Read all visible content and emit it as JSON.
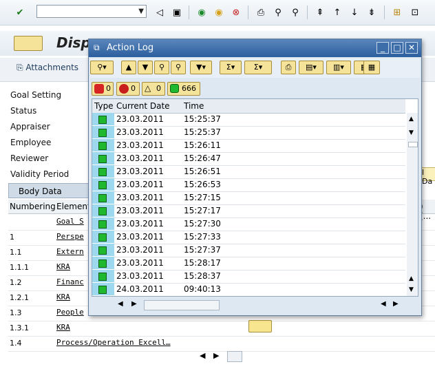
{
  "main": {
    "page_title": "Disp",
    "attachments_label": "Attachments",
    "fields": [
      "Goal Setting",
      "Status",
      "Appraiser",
      "Employee",
      "Reviewer",
      "Validity Period"
    ],
    "right_cell_text": "l Da",
    "body_tab": "Body Data",
    "grid_headers": {
      "numbering": "Numbering",
      "element": "Element",
      "right": ") (..."
    },
    "rows": [
      {
        "num": "",
        "elem": "Goal S"
      },
      {
        "num": "1",
        "elem": "Perspe"
      },
      {
        "num": "1.1",
        "elem": "Extern"
      },
      {
        "num": "1.1.1",
        "elem": "KRA"
      },
      {
        "num": "1.2",
        "elem": "Financ"
      },
      {
        "num": "1.2.1",
        "elem": "KRA"
      },
      {
        "num": "1.3",
        "elem": "People"
      },
      {
        "num": "1.3.1",
        "elem": "KRA"
      },
      {
        "num": "1.4",
        "elem": "Process/Operation Excell…"
      }
    ]
  },
  "dialog": {
    "title": "Action Log",
    "status": {
      "stop": "0",
      "error": "0",
      "warning": "0",
      "success": "666"
    },
    "columns": {
      "type": "Type",
      "date": "Current Date",
      "time": "Time"
    },
    "rows": [
      {
        "date": "23.03.2011",
        "time": "15:25:37"
      },
      {
        "date": "23.03.2011",
        "time": "15:25:37"
      },
      {
        "date": "23.03.2011",
        "time": "15:26:11"
      },
      {
        "date": "23.03.2011",
        "time": "15:26:47"
      },
      {
        "date": "23.03.2011",
        "time": "15:26:51"
      },
      {
        "date": "23.03.2011",
        "time": "15:26:53"
      },
      {
        "date": "23.03.2011",
        "time": "15:27:15"
      },
      {
        "date": "23.03.2011",
        "time": "15:27:17"
      },
      {
        "date": "23.03.2011",
        "time": "15:27:30"
      },
      {
        "date": "23.03.2011",
        "time": "15:27:33"
      },
      {
        "date": "23.03.2011",
        "time": "15:27:37"
      },
      {
        "date": "23.03.2011",
        "time": "15:28:17"
      },
      {
        "date": "23.03.2011",
        "time": "15:28:37"
      },
      {
        "date": "24.03.2011",
        "time": "09:40:13"
      }
    ]
  },
  "colors": {
    "success": "#1fb82e",
    "type_cell": "#9ed8ee",
    "title_bar": "#2b5f9e"
  }
}
